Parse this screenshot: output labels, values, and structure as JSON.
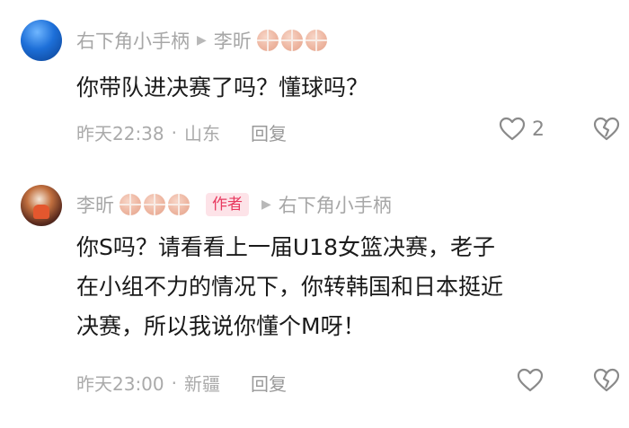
{
  "comments": [
    {
      "author": "右下角小手柄",
      "reply_to": "李昕",
      "text_lines": [
        "你带队进决赛了吗？懂球吗？"
      ],
      "time": "昨天22:38",
      "separator": "·",
      "location": "山东",
      "reply_label": "回复",
      "like_count": "2",
      "badges": [
        "basketball",
        "basketball",
        "basketball"
      ]
    },
    {
      "author": "李昕",
      "author_badge": "作者",
      "reply_to": "右下角小手柄",
      "text_lines": [
        "你S吗？请看看上一届U18女篮决赛，老子",
        "在小组不力的情况下，你转韩国和日本挺近",
        "决赛，所以我说你懂个M呀！"
      ],
      "time": "昨天23:00",
      "separator": "·",
      "location": "新疆",
      "reply_label": "回复",
      "badges": [
        "basketball",
        "basketball",
        "basketball"
      ]
    }
  ],
  "icons": {
    "like": "heart-outline-icon",
    "dislike": "broken-heart-outline-icon",
    "arrow": "right-triangle-icon",
    "badge": "basketball-icon"
  }
}
